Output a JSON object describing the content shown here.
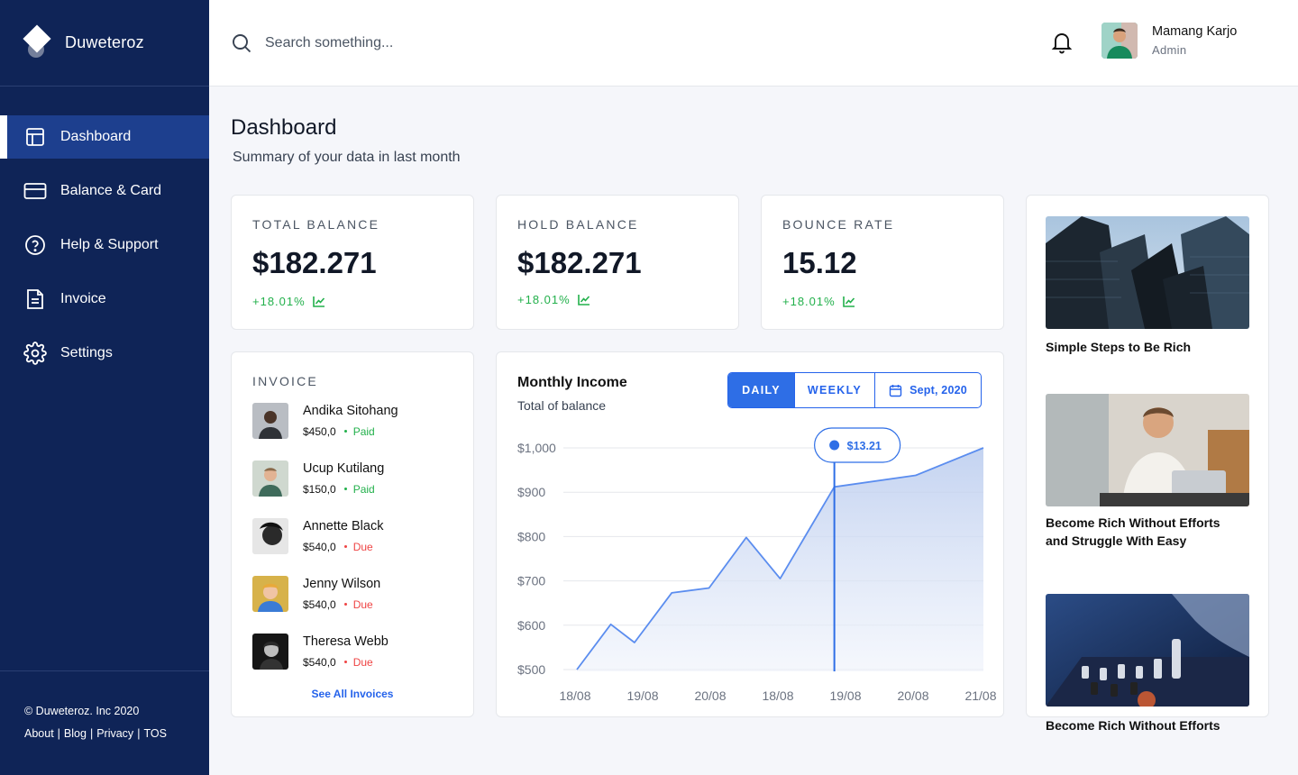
{
  "brand": {
    "name": "Duweteroz"
  },
  "nav": {
    "items": [
      {
        "label": "Dashboard",
        "icon": "layout-icon",
        "active": true
      },
      {
        "label": "Balance & Card",
        "icon": "credit-card-icon"
      },
      {
        "label": "Help & Support",
        "icon": "help-circle-icon"
      },
      {
        "label": "Invoice",
        "icon": "document-icon"
      },
      {
        "label": "Settings",
        "icon": "gear-icon"
      }
    ]
  },
  "footer": {
    "copyright": "© Duweteroz. Inc 2020",
    "links": [
      "About",
      "Blog",
      "Privacy",
      "TOS"
    ]
  },
  "header": {
    "search_placeholder": "Search something...",
    "user_name": "Mamang Karjo",
    "user_role": "Admin"
  },
  "page": {
    "title": "Dashboard",
    "subtitle": "Summary of your data in last month"
  },
  "stats": [
    {
      "label": "TOTAL BALANCE",
      "value": "$182.271",
      "delta": "+18.01%"
    },
    {
      "label": "HOLD BALANCE",
      "value": "$182.271",
      "delta": "+18.01%"
    },
    {
      "label": "BOUNCE RATE",
      "value": "15.12",
      "delta": "+18.01%"
    }
  ],
  "invoice": {
    "title": "INVOICE",
    "items": [
      {
        "name": "Andika Sitohang",
        "amount": "$450,0",
        "status": "Paid"
      },
      {
        "name": "Ucup Kutilang",
        "amount": "$150,0",
        "status": "Paid"
      },
      {
        "name": "Annette Black",
        "amount": "$540,0",
        "status": "Due"
      },
      {
        "name": "Jenny Wilson",
        "amount": "$540,0",
        "status": "Due"
      },
      {
        "name": "Theresa Webb",
        "amount": "$540,0",
        "status": "Due"
      }
    ],
    "see_all": "See All Invoices"
  },
  "income": {
    "title": "Monthly Income",
    "subtitle": "Total of balance",
    "tabs": [
      "DAILY",
      "WEEKLY"
    ],
    "date_label": "Sept, 2020",
    "tooltip": "$13.21"
  },
  "chart_data": {
    "type": "area",
    "title": "Monthly Income",
    "x_tick_labels": [
      "18/08",
      "19/08",
      "20/08",
      "18/08",
      "19/08",
      "20/08",
      "21/08"
    ],
    "y_tick_labels": [
      "$1,000",
      "$900",
      "$800",
      "$700",
      "$600",
      "$500"
    ],
    "ylim": [
      500,
      1000
    ],
    "x": [
      0,
      0.5,
      0.85,
      1.4,
      1.95,
      2.5,
      3.0,
      3.8,
      5.0,
      6.0
    ],
    "values": [
      500,
      602,
      561,
      673,
      684,
      798,
      705,
      912,
      938,
      1000
    ],
    "highlight": {
      "x": 3.8,
      "label": "$13.21"
    },
    "grid": true,
    "series_color": "#5b8def"
  },
  "articles": [
    {
      "title": "Simple Steps to Be Rich"
    },
    {
      "title": "Become Rich Without Efforts and Struggle With Easy"
    },
    {
      "title": "Become Rich Without Efforts"
    }
  ],
  "colors": {
    "sidebar": "#0f2457",
    "active": "#1d3f8e",
    "accent": "#2e6ee6",
    "positive": "#22b04b",
    "negative": "#ef4444"
  }
}
